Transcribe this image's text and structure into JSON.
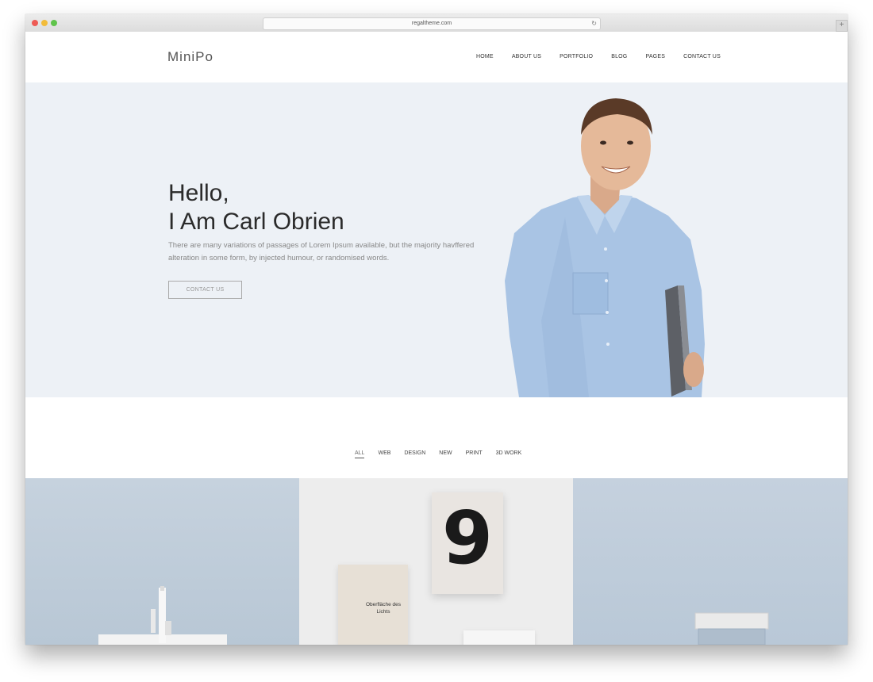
{
  "browser": {
    "url": "regaltheme.com",
    "newtab_symbol": "+",
    "reload_symbol": "↻"
  },
  "site": {
    "logo": "MiniPo",
    "nav": [
      "HOME",
      "ABOUT US",
      "PORTFOLIO",
      "BLOG",
      "PAGES",
      "CONTACT US"
    ]
  },
  "hero": {
    "title_line1": "Hello,",
    "title_line2": "I Am Carl Obrien",
    "text": "There are many variations of passages of Lorem Ipsum available, but the majority havffered alteration in some form, by injected humour, or randomised words.",
    "button": "CONTACT US",
    "background_color": "#edf1f6"
  },
  "portfolio": {
    "filters": [
      "ALL",
      "WEB",
      "DESIGN",
      "NEW",
      "PRINT",
      "3D WORK"
    ],
    "active_filter": "ALL",
    "tile2": {
      "poster_number": "9",
      "book_title": "Oberfläche des Lichts"
    }
  }
}
